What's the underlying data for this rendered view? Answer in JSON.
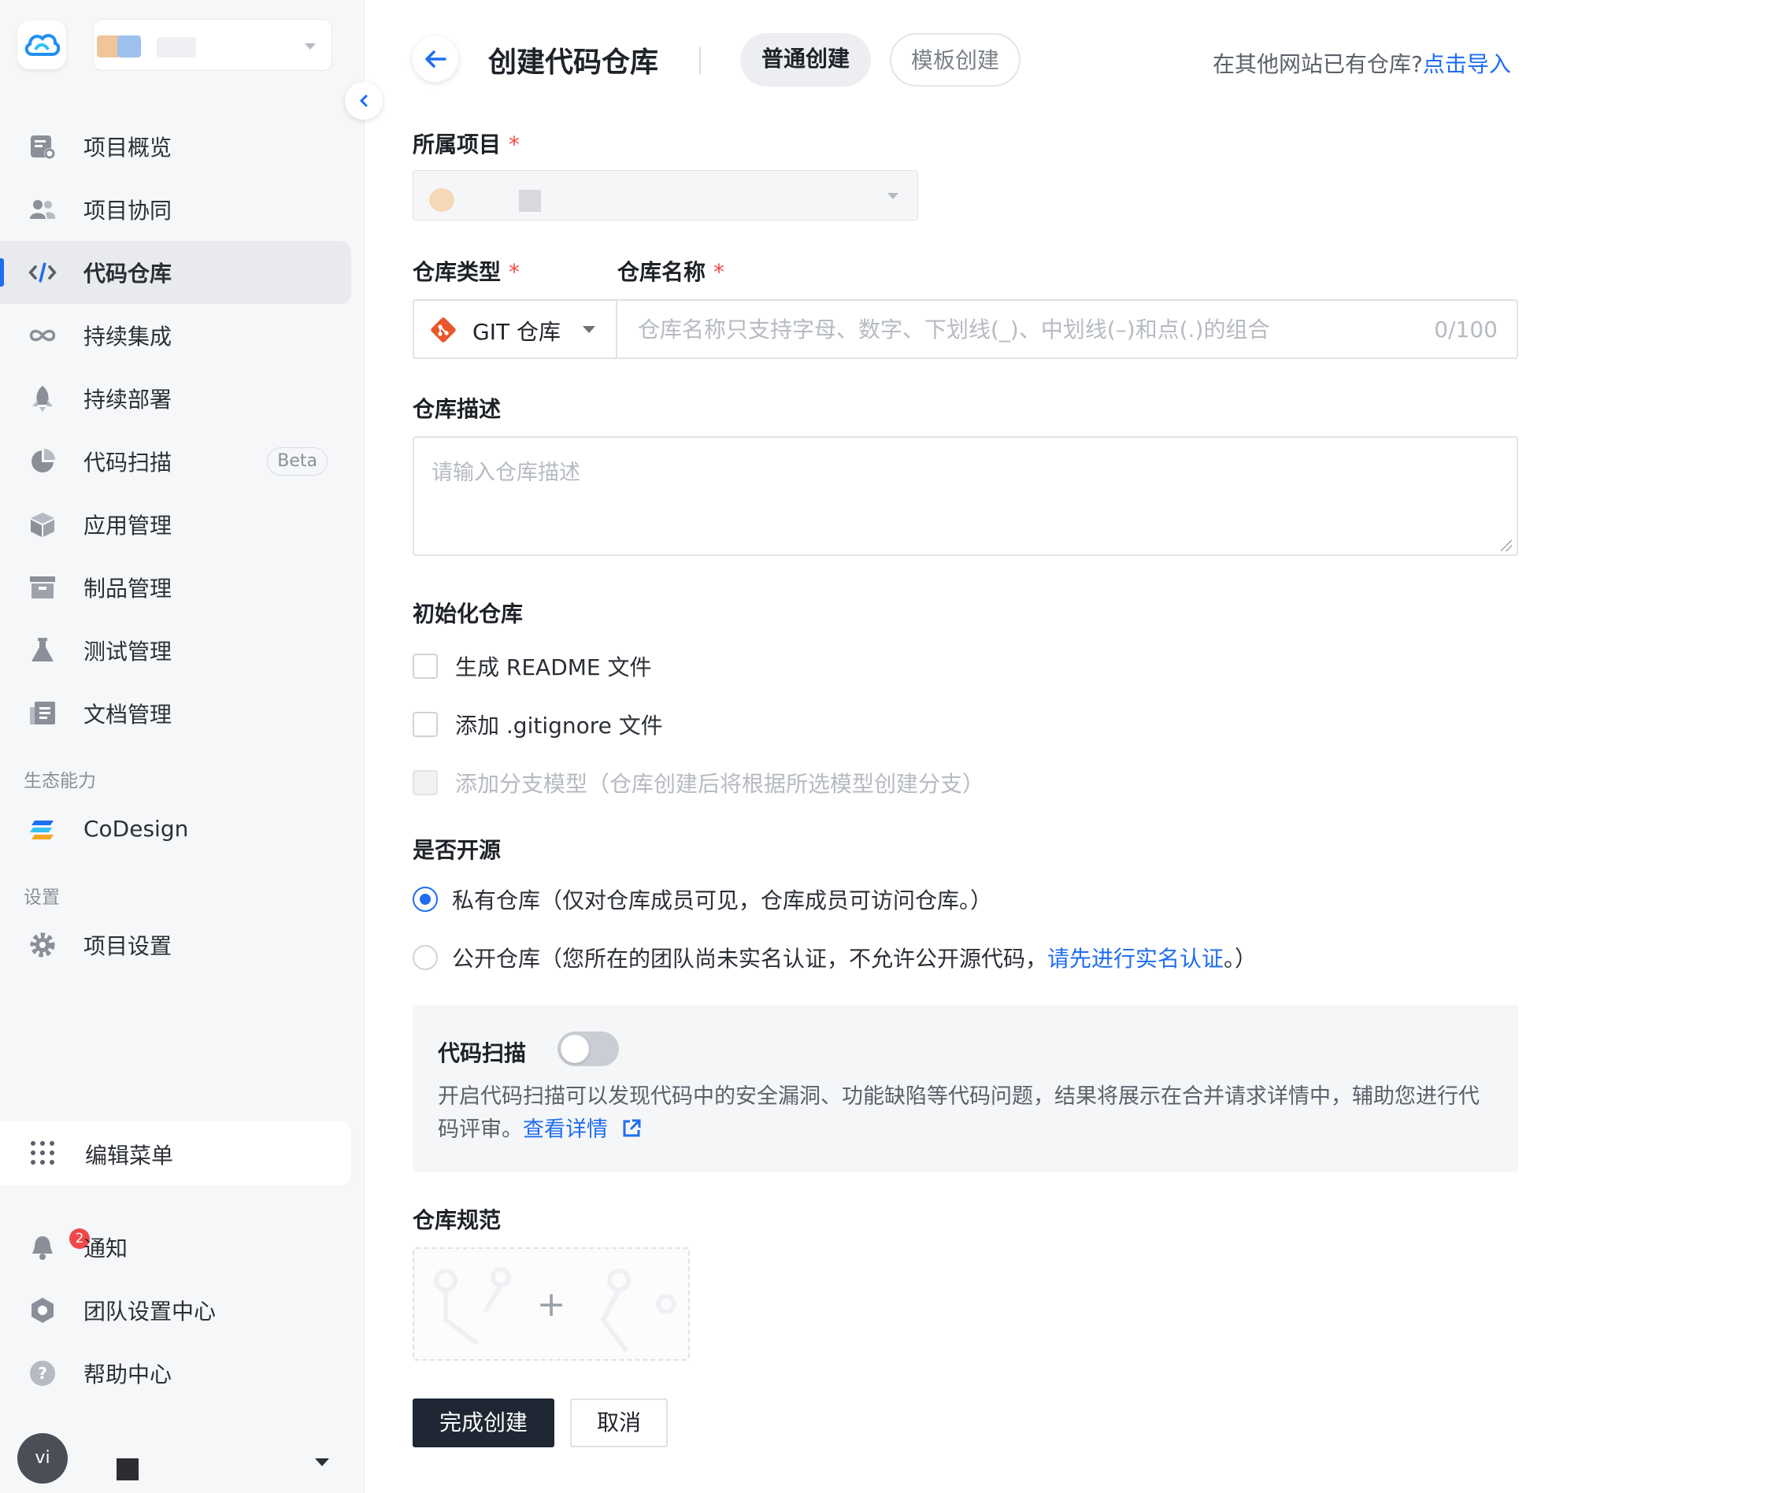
{
  "sidebar": {
    "items": [
      {
        "label": "项目概览",
        "icon": "project-overview-icon"
      },
      {
        "label": "项目协同",
        "icon": "people-icon"
      },
      {
        "label": "代码仓库",
        "icon": "code-icon",
        "active": true
      },
      {
        "label": "持续集成",
        "icon": "infinity-icon"
      },
      {
        "label": "持续部署",
        "icon": "rocket-icon"
      },
      {
        "label": "代码扫描",
        "icon": "pie-icon",
        "badge": "Beta"
      },
      {
        "label": "应用管理",
        "icon": "cube-icon"
      },
      {
        "label": "制品管理",
        "icon": "archive-icon"
      },
      {
        "label": "测试管理",
        "icon": "flask-icon"
      },
      {
        "label": "文档管理",
        "icon": "document-icon"
      }
    ],
    "ecosystem_label": "生态能力",
    "codesign_label": "CoDesign",
    "settings_section_label": "设置",
    "project_settings_label": "项目设置",
    "edit_menu_label": "编辑菜单",
    "notify_label": "通知",
    "notify_count": "2",
    "team_settings_label": "团队设置中心",
    "help_label": "帮助中心",
    "avatar_text": "vi"
  },
  "header": {
    "title": "创建代码仓库",
    "tab_normal": "普通创建",
    "tab_template": "模板创建",
    "import_prompt": "在其他网站已有仓库?",
    "import_link": "点击导入"
  },
  "form": {
    "project_label": "所属项目",
    "required_mark": "*",
    "repo_type_label": "仓库类型",
    "repo_name_label": "仓库名称",
    "repo_type_value": "GIT 仓库",
    "repo_name_placeholder": "仓库名称只支持字母、数字、下划线(_)、中划线(–)和点(.)的组合",
    "repo_name_counter": "0/100",
    "desc_label": "仓库描述",
    "desc_placeholder": "请输入仓库描述",
    "init_label": "初始化仓库",
    "init_readme": "生成 README 文件",
    "init_gitignore": "添加 .gitignore 文件",
    "init_branch_model": "添加分支模型（仓库创建后将根据所选模型创建分支）",
    "open_source_label": "是否开源",
    "private_option": "私有仓库（仅对仓库成员可见，仓库成员可访问仓库。）",
    "public_option_prefix": "公开仓库（您所在的团队尚未实名认证，不允许公开源代码，",
    "public_option_link": "请先进行实名认证",
    "public_option_suffix": "。）",
    "scan_title": "代码扫描",
    "scan_desc": "开启代码扫描可以发现代码中的安全漏洞、功能缺陷等代码问题，结果将展示在合并请求详情中，辅助您进行代码评审。",
    "scan_link": "查看详情",
    "spec_label": "仓库规范",
    "spec_add": "+",
    "submit_label": "完成创建",
    "cancel_label": "取消"
  },
  "colors": {
    "accent": "#1f6df0",
    "primary_button": "#1e2733",
    "required": "#f04848",
    "git_icon": "#e8582c"
  }
}
